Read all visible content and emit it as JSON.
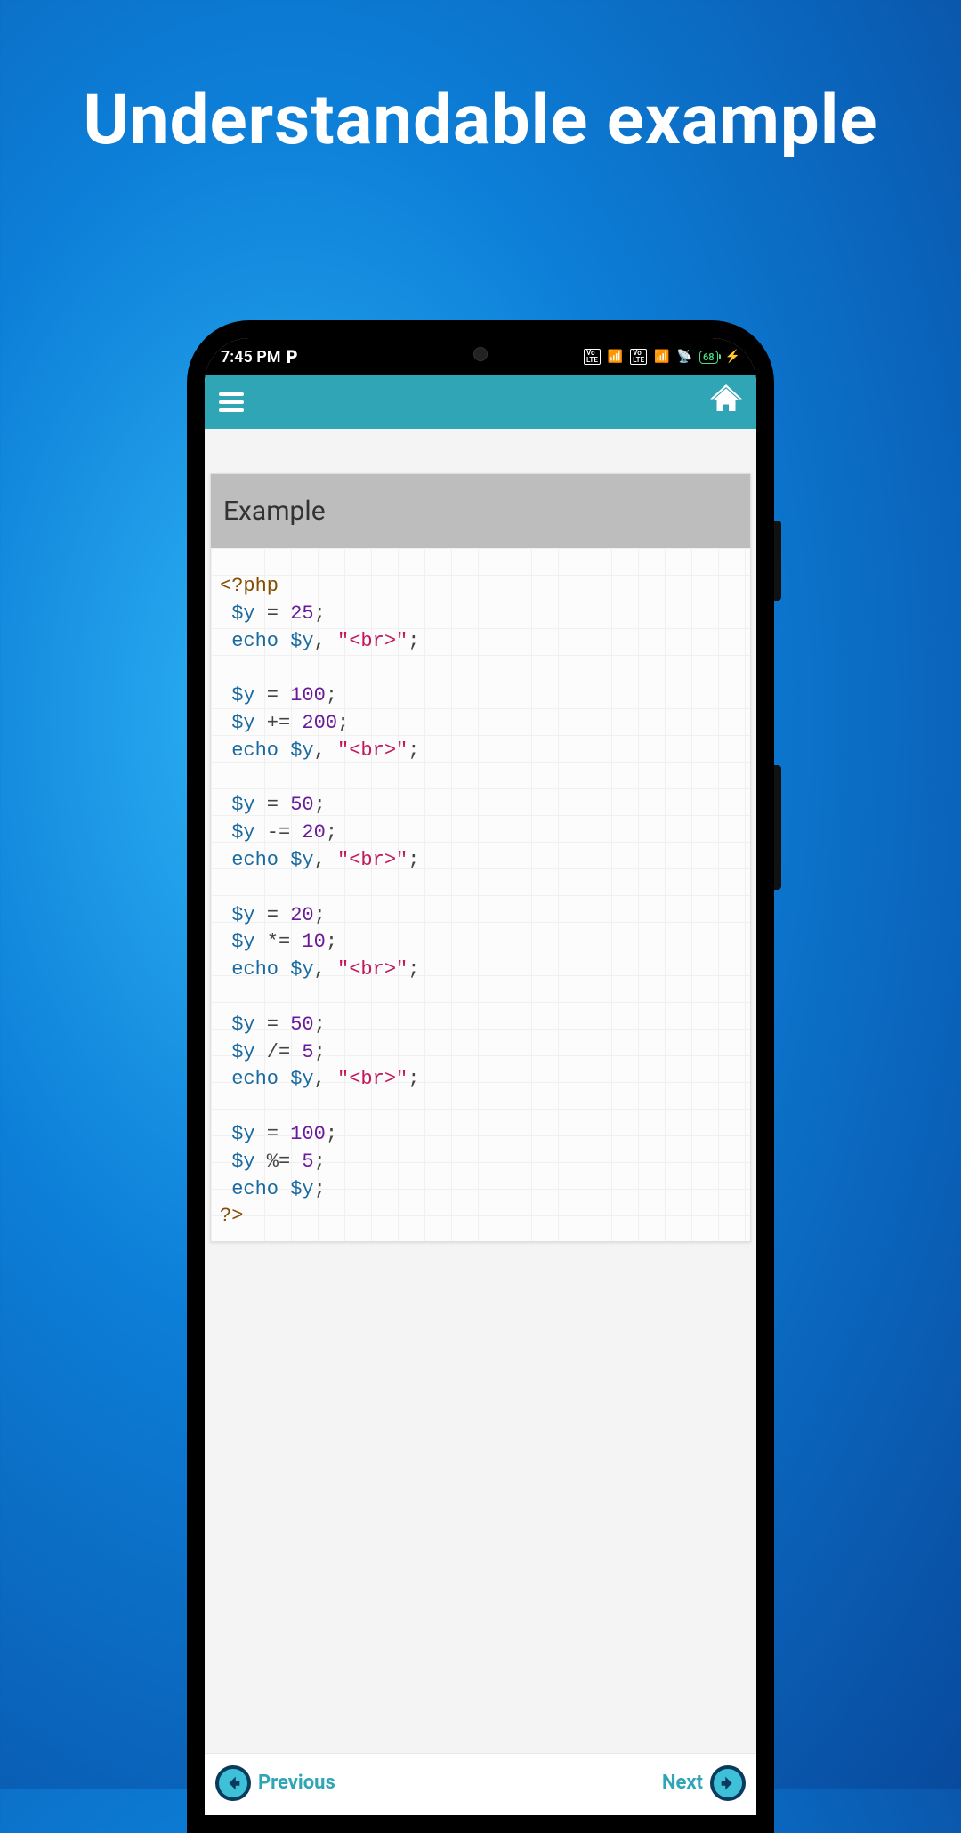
{
  "page": {
    "title": "Understandable example"
  },
  "statusBar": {
    "time": "7:45 PM",
    "indicator": "P",
    "battery": "68"
  },
  "appBar": {
    "menuIcon": "hamburger-icon",
    "homeIcon": "home-icon"
  },
  "example": {
    "header": "Example",
    "code": {
      "open": "<?php",
      "close": "?>",
      "blocks": [
        {
          "lines": [
            {
              "tokens": [
                {
                  "t": "var",
                  "v": "$y"
                },
                {
                  "t": "op",
                  "v": " = "
                },
                {
                  "t": "num",
                  "v": "25"
                },
                {
                  "t": "op",
                  "v": ";"
                }
              ]
            },
            {
              "tokens": [
                {
                  "t": "fn",
                  "v": "echo"
                },
                {
                  "t": "op",
                  "v": " "
                },
                {
                  "t": "var",
                  "v": "$y"
                },
                {
                  "t": "op",
                  "v": ", "
                },
                {
                  "t": "str",
                  "v": "\"<br>\""
                },
                {
                  "t": "op",
                  "v": ";"
                }
              ]
            }
          ]
        },
        {
          "lines": [
            {
              "tokens": [
                {
                  "t": "var",
                  "v": "$y"
                },
                {
                  "t": "op",
                  "v": " = "
                },
                {
                  "t": "num",
                  "v": "100"
                },
                {
                  "t": "op",
                  "v": ";"
                }
              ]
            },
            {
              "tokens": [
                {
                  "t": "var",
                  "v": "$y"
                },
                {
                  "t": "op",
                  "v": " += "
                },
                {
                  "t": "num",
                  "v": "200"
                },
                {
                  "t": "op",
                  "v": ";"
                }
              ]
            },
            {
              "tokens": [
                {
                  "t": "fn",
                  "v": "echo"
                },
                {
                  "t": "op",
                  "v": " "
                },
                {
                  "t": "var",
                  "v": "$y"
                },
                {
                  "t": "op",
                  "v": ", "
                },
                {
                  "t": "str",
                  "v": "\"<br>\""
                },
                {
                  "t": "op",
                  "v": ";"
                }
              ]
            }
          ]
        },
        {
          "lines": [
            {
              "tokens": [
                {
                  "t": "var",
                  "v": "$y"
                },
                {
                  "t": "op",
                  "v": " = "
                },
                {
                  "t": "num",
                  "v": "50"
                },
                {
                  "t": "op",
                  "v": ";"
                }
              ]
            },
            {
              "tokens": [
                {
                  "t": "var",
                  "v": "$y"
                },
                {
                  "t": "op",
                  "v": " -= "
                },
                {
                  "t": "num",
                  "v": "20"
                },
                {
                  "t": "op",
                  "v": ";"
                }
              ]
            },
            {
              "tokens": [
                {
                  "t": "fn",
                  "v": "echo"
                },
                {
                  "t": "op",
                  "v": " "
                },
                {
                  "t": "var",
                  "v": "$y"
                },
                {
                  "t": "op",
                  "v": ", "
                },
                {
                  "t": "str",
                  "v": "\"<br>\""
                },
                {
                  "t": "op",
                  "v": ";"
                }
              ]
            }
          ]
        },
        {
          "lines": [
            {
              "tokens": [
                {
                  "t": "var",
                  "v": "$y"
                },
                {
                  "t": "op",
                  "v": " = "
                },
                {
                  "t": "num",
                  "v": "20"
                },
                {
                  "t": "op",
                  "v": ";"
                }
              ]
            },
            {
              "tokens": [
                {
                  "t": "var",
                  "v": "$y"
                },
                {
                  "t": "op",
                  "v": " *= "
                },
                {
                  "t": "num",
                  "v": "10"
                },
                {
                  "t": "op",
                  "v": ";"
                }
              ]
            },
            {
              "tokens": [
                {
                  "t": "fn",
                  "v": "echo"
                },
                {
                  "t": "op",
                  "v": " "
                },
                {
                  "t": "var",
                  "v": "$y"
                },
                {
                  "t": "op",
                  "v": ", "
                },
                {
                  "t": "str",
                  "v": "\"<br>\""
                },
                {
                  "t": "op",
                  "v": ";"
                }
              ]
            }
          ]
        },
        {
          "lines": [
            {
              "tokens": [
                {
                  "t": "var",
                  "v": "$y"
                },
                {
                  "t": "op",
                  "v": " = "
                },
                {
                  "t": "num",
                  "v": "50"
                },
                {
                  "t": "op",
                  "v": ";"
                }
              ]
            },
            {
              "tokens": [
                {
                  "t": "var",
                  "v": "$y"
                },
                {
                  "t": "op",
                  "v": " /= "
                },
                {
                  "t": "num",
                  "v": "5"
                },
                {
                  "t": "op",
                  "v": ";"
                }
              ]
            },
            {
              "tokens": [
                {
                  "t": "fn",
                  "v": "echo"
                },
                {
                  "t": "op",
                  "v": " "
                },
                {
                  "t": "var",
                  "v": "$y"
                },
                {
                  "t": "op",
                  "v": ", "
                },
                {
                  "t": "str",
                  "v": "\"<br>\""
                },
                {
                  "t": "op",
                  "v": ";"
                }
              ]
            }
          ]
        },
        {
          "lines": [
            {
              "tokens": [
                {
                  "t": "var",
                  "v": "$y"
                },
                {
                  "t": "op",
                  "v": " = "
                },
                {
                  "t": "num",
                  "v": "100"
                },
                {
                  "t": "op",
                  "v": ";"
                }
              ]
            },
            {
              "tokens": [
                {
                  "t": "var",
                  "v": "$y"
                },
                {
                  "t": "op",
                  "v": " %= "
                },
                {
                  "t": "num",
                  "v": "5"
                },
                {
                  "t": "op",
                  "v": ";"
                }
              ]
            },
            {
              "tokens": [
                {
                  "t": "fn",
                  "v": "echo"
                },
                {
                  "t": "op",
                  "v": " "
                },
                {
                  "t": "var",
                  "v": "$y"
                },
                {
                  "t": "op",
                  "v": ";"
                }
              ]
            }
          ]
        }
      ]
    }
  },
  "nav": {
    "prev": "Previous",
    "next": "Next"
  }
}
